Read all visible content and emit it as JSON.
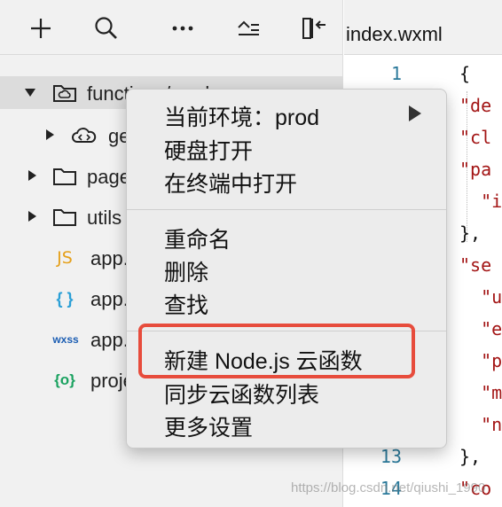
{
  "toolbar": {
    "add_icon": "plus-icon",
    "search_icon": "search-icon",
    "more_icon": "ellipsis-icon",
    "collapse_icon": "collapse-all-icon",
    "split_icon": "split-panel-icon"
  },
  "tree": {
    "items": [
      {
        "label": "functions/prod",
        "icon": "cloud-folder-icon"
      },
      {
        "label": "getOpenid",
        "icon": "cloud-function-icon"
      },
      {
        "label": "pages",
        "icon": "folder-icon"
      },
      {
        "label": "utils",
        "icon": "folder-icon"
      },
      {
        "label": "app.js",
        "icon_text": "JS"
      },
      {
        "label": "app.json",
        "icon_text": "{ }"
      },
      {
        "label": "app.wxss",
        "icon_text": "wxss"
      },
      {
        "label": "project.config.json",
        "icon_text": "{o}"
      }
    ]
  },
  "editor": {
    "tab_label": "index.wxml",
    "line_numbers": [
      "1",
      "13",
      "14"
    ],
    "code_lines": [
      "{",
      "\"de",
      "\"cl",
      "\"pa",
      "  \"i",
      "},",
      "\"se",
      "  \"u",
      "  \"e",
      "  \"p",
      "  \"m",
      "  \"n",
      "},",
      "\"co"
    ]
  },
  "context_menu": {
    "items": {
      "env": "当前环境：prod",
      "open_disk": "硬盘打开",
      "open_terminal": "在终端中打开",
      "rename": "重命名",
      "delete": "删除",
      "find": "查找",
      "new_cloud_function": "新建 Node.js 云函数",
      "sync_list": "同步云函数列表",
      "more_settings": "更多设置"
    }
  },
  "watermark": "https://blog.csdn.net/qiushi_1990",
  "colors": {
    "highlight": "#e74c3c",
    "line_number": "#2b7a9b",
    "json_key": "#a31515",
    "js_icon": "#e5a01b",
    "json_icon": "#2a9fd6",
    "wxss_icon": "#1c5eb3",
    "config_icon": "#1aa260"
  }
}
